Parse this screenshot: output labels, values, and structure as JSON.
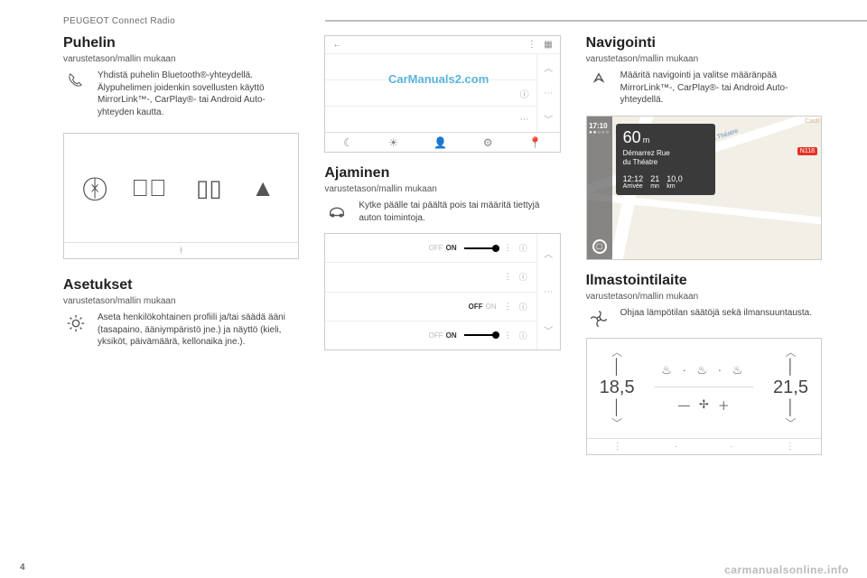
{
  "page": {
    "number": "4",
    "header": "PEUGEOT Connect Radio"
  },
  "watermarks": {
    "w1": "CarManuals2.com",
    "w2": "carmanualsonline.info"
  },
  "phone": {
    "title": "Puhelin",
    "subtitle": "varustetason/mallin mukaan",
    "desc": "Yhdistä puhelin Bluetooth®-yhteydellä.\nÄlypuhelimen joidenkin sovellusten käyttö MirrorLink™-, CarPlay®- tai Android Auto-yhteyden kautta.",
    "panel_icons": [
      "bluetooth-ring-icon",
      "play-ring-icon",
      "phone-mirror-icon",
      "android-auto-icon"
    ],
    "foot_icon": "bluetooth-small-icon"
  },
  "settings": {
    "title": "Asetukset",
    "subtitle": "varustetason/mallin mukaan",
    "desc": "Aseta henkilökohtainen profiili ja/tai säädä ääni (tasapaino, ääniympäristö jne.) ja näyttö (kieli, yksiköt, päivämäärä, kellonaika jne.)."
  },
  "shortcuts": {
    "back": "←",
    "more": "⋮",
    "grid": "▦",
    "row_info": "ⓘ",
    "row_more": "⋯",
    "side": [
      "︿",
      "⋯",
      "﹀"
    ],
    "foot": [
      "☾",
      "☀",
      "👤",
      "⚙",
      "📍"
    ]
  },
  "driving": {
    "title": "Ajaminen",
    "subtitle": "varustetason/mallin mukaan",
    "desc": "Kytke päälle tai päältä pois tai määritä tiettyjä auton toimintoja.",
    "rows": [
      {
        "off": "OFF",
        "on": "ON",
        "active": "on",
        "menu": "⋮",
        "info": "ⓘ"
      },
      {
        "menu": "⋮",
        "info": "ⓘ"
      },
      {
        "off": "OFF",
        "on": "ON",
        "active": "off",
        "menu": "⋮",
        "info": "ⓘ"
      },
      {
        "off": "OFF",
        "on": "ON",
        "active": "on",
        "menu": "⋮",
        "info": "ⓘ"
      }
    ],
    "side": [
      "︿",
      "⋯",
      "﹀"
    ]
  },
  "nav": {
    "title": "Navigointi",
    "subtitle": "varustetason/mallin mukaan",
    "desc": "Määritä navigointi ja valitse määränpää MirrorLink™-, CarPlay®- tai Android Auto-yhteydellä.",
    "map": {
      "clock": "17:10",
      "dots": "●●○○○",
      "stop": "▢",
      "distance_value": "60",
      "distance_unit": "m",
      "dest_line1": "Démarrez Rue",
      "dest_line2": "du Théatre",
      "eta_time": "12:12",
      "eta_time_label": "Arrivée",
      "eta_min": "21",
      "eta_min_label": "mn",
      "eta_dist": "10,0",
      "eta_dist_label": "km",
      "road_badge": "N118",
      "street_label": "Rue du Théatre",
      "castle": "Castl"
    }
  },
  "climate": {
    "title": "Ilmastointilaite",
    "subtitle": "varustetason/mallin mukaan",
    "desc": "Ohjaa lämpötilan säätöjä sekä ilmansuuntausta.",
    "temp_left": "18,5",
    "temp_right": "21,5",
    "seat_icons": "♨ · ♨ · ♨",
    "fan_minus": "—",
    "fan_icon": "✢",
    "fan_plus": "＋",
    "foot": [
      "⋮",
      "·",
      "·",
      "⋮"
    ]
  }
}
